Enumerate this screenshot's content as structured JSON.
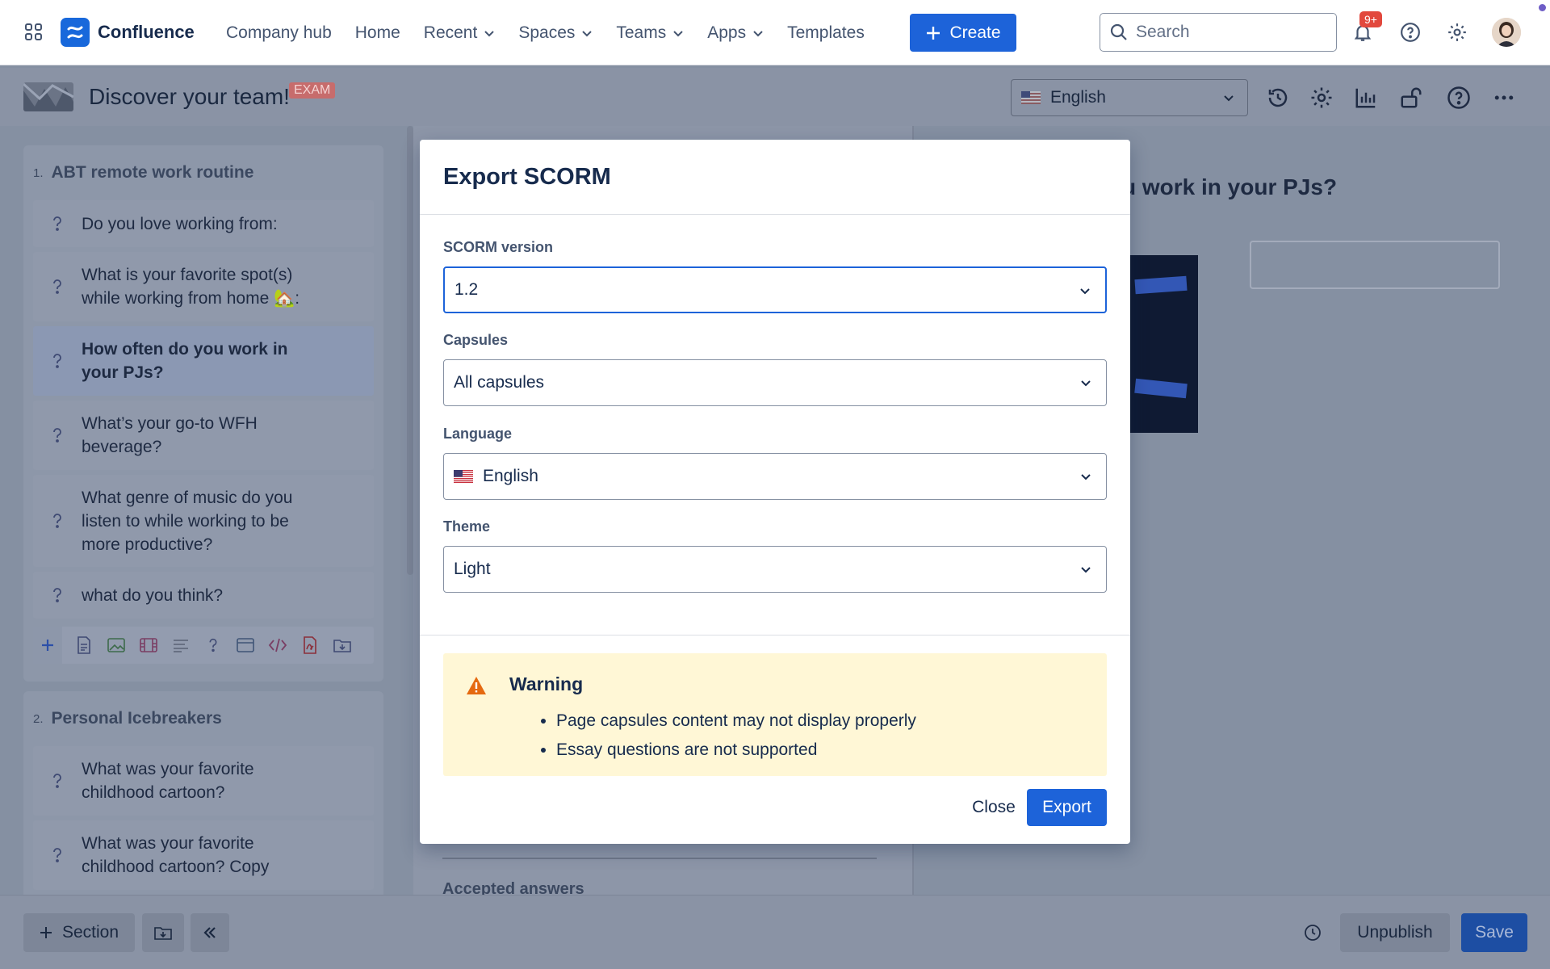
{
  "topnav": {
    "app_name": "Confluence",
    "links": [
      {
        "label": "Company hub",
        "dropdown": false
      },
      {
        "label": "Home",
        "dropdown": false
      },
      {
        "label": "Recent",
        "dropdown": true
      },
      {
        "label": "Spaces",
        "dropdown": true
      },
      {
        "label": "Teams",
        "dropdown": true
      },
      {
        "label": "Apps",
        "dropdown": true
      },
      {
        "label": "Templates",
        "dropdown": false
      }
    ],
    "create_label": "Create",
    "search_placeholder": "Search",
    "notifications_badge": "9+"
  },
  "page": {
    "title": "Discover your team!",
    "badge": "EXAM",
    "language": "English"
  },
  "left_panel": {
    "sections": [
      {
        "number": "1.",
        "title": "ABT remote work routine",
        "items": [
          {
            "label": "Do you love working from:",
            "active": false
          },
          {
            "label": "What is your favorite spot(s) while working from home 🏡:",
            "active": false
          },
          {
            "label": "How often do you work in your PJs?",
            "active": true
          },
          {
            "label": "What’s your go-to WFH beverage?",
            "active": false
          },
          {
            "label": "What genre of music do you listen to while working to be more productive?",
            "active": false
          },
          {
            "label": "what do you think?",
            "active": false
          }
        ]
      },
      {
        "number": "2.",
        "title": "Personal Icebreakers",
        "items": [
          {
            "label": "What was your favorite childhood cartoon?",
            "active": false
          },
          {
            "label": "What was your favorite childhood cartoon? Copy",
            "active": false
          }
        ]
      }
    ]
  },
  "middle_panel": {
    "accepted_answers_label": "Accepted answers"
  },
  "right_panel": {
    "question_title": "u work in your PJs?"
  },
  "bottombar": {
    "section_label": "Section",
    "unpublish_label": "Unpublish",
    "save_label": "Save"
  },
  "modal": {
    "title": "Export SCORM",
    "fields": {
      "scorm_version": {
        "label": "SCORM version",
        "value": "1.2"
      },
      "capsules": {
        "label": "Capsules",
        "value": "All capsules"
      },
      "language": {
        "label": "Language",
        "value": "English"
      },
      "theme": {
        "label": "Theme",
        "value": "Light"
      }
    },
    "warning": {
      "title": "Warning",
      "items": [
        "Page capsules content may not display properly",
        "Essay questions are not supported"
      ]
    },
    "close_label": "Close",
    "export_label": "Export"
  },
  "colors": {
    "primary": "#1d63d9",
    "warning_bg": "#fff7d6",
    "warning_icon": "#e56910",
    "badge_red": "#e2483d",
    "overlay": "#8590a2"
  }
}
